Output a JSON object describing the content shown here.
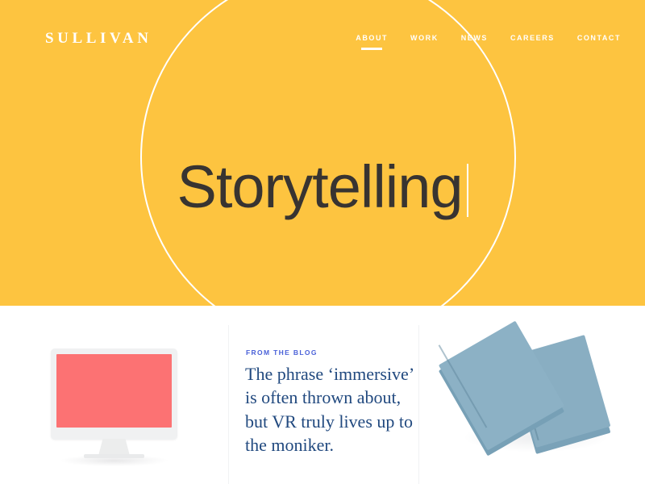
{
  "site": {
    "brand": "SULLIVAN",
    "theme": {
      "hero_background": "#fdc440",
      "hero_circle_stroke": "#ffffff",
      "headline_color": "#383431",
      "blog_eyebrow_color": "#4a61d8",
      "blog_headline_color": "#21497f",
      "monitor_screen_color": "#fc7273",
      "book_color": "#8cb1c5",
      "divider_color": "#f1f2f4"
    }
  },
  "nav": {
    "items": [
      {
        "label": "ABOUT",
        "active": true
      },
      {
        "label": "WORK",
        "active": false
      },
      {
        "label": "NEWS",
        "active": false
      },
      {
        "label": "CAREERS",
        "active": false
      },
      {
        "label": "CONTACT",
        "active": false
      }
    ]
  },
  "hero": {
    "headline": "Storytelling",
    "caret_visible": true,
    "scroll_hint": "scroll-down-notch"
  },
  "panels": {
    "monitor": {
      "icon": "desktop-monitor-illustration",
      "screen_color": "#fc7273"
    },
    "blog": {
      "eyebrow": "FROM THE BLOG",
      "headline": "The phrase ‘immersive’ is often thrown about, but VR truly lives up to the moniker."
    },
    "books": {
      "icon": "stacked-books-illustration",
      "count": 2
    }
  }
}
